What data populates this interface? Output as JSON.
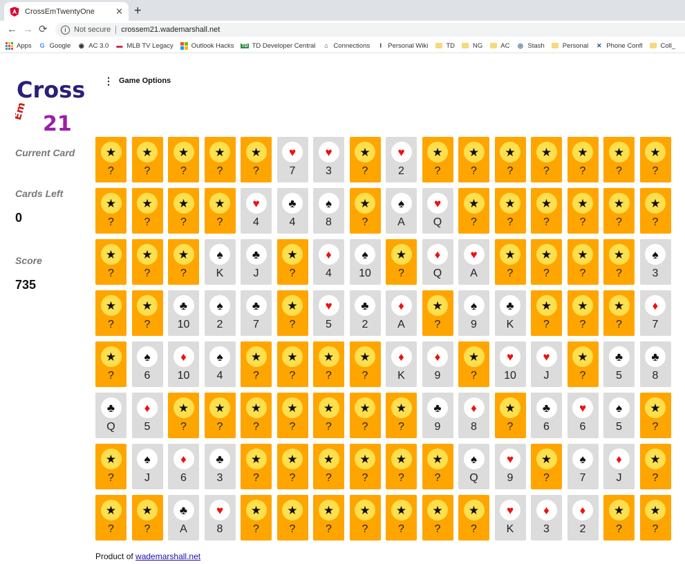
{
  "browser": {
    "tab_title": "CrossEmTwentyOne",
    "close_glyph": "✕",
    "new_tab_glyph": "+",
    "back_glyph": "←",
    "forward_glyph": "→",
    "reload_glyph": "⟳",
    "security_label": "Not secure",
    "url": "crossem21.wademarshall.net",
    "bookmarks": [
      {
        "label": "Apps",
        "icon": "apps-grid-icon"
      },
      {
        "label": "Google",
        "icon": "google-icon"
      },
      {
        "label": "AC 3.0",
        "icon": "ac-icon"
      },
      {
        "label": "MLB TV Legacy",
        "icon": "mlb-icon"
      },
      {
        "label": "Outlook Hacks",
        "icon": "windows-icon"
      },
      {
        "label": "TD Developer Central",
        "icon": "td-icon"
      },
      {
        "label": "Connections",
        "icon": "connections-icon"
      },
      {
        "label": "Personal Wiki",
        "icon": "wiki-icon"
      },
      {
        "label": "TD",
        "icon": "folder-icon"
      },
      {
        "label": "NG",
        "icon": "folder-icon"
      },
      {
        "label": "AC",
        "icon": "folder-icon"
      },
      {
        "label": "Stash",
        "icon": "stash-icon"
      },
      {
        "label": "Personal",
        "icon": "folder-icon"
      },
      {
        "label": "Phone Confl",
        "icon": "tools-icon"
      },
      {
        "label": "Coll_",
        "icon": "folder-icon"
      }
    ]
  },
  "logo": {
    "line1": "Cross",
    "line2": "Em",
    "line3": "21"
  },
  "menu": {
    "game_options_label": "Game Options"
  },
  "sidebar": {
    "current_card_label": "Current Card",
    "cards_left_label": "Cards Left",
    "cards_left_value": "0",
    "score_label": "Score",
    "score_value": "735"
  },
  "board": {
    "hidden_symbol": "★",
    "hidden_label": "?",
    "suit_symbols": {
      "H": "♥",
      "D": "♦",
      "C": "♣",
      "S": "♠"
    },
    "colors": {
      "hidden_bg": "#ffa500",
      "hidden_badge": "#fedf4e",
      "revealed_bg": "#dcdcdc",
      "red_suit": "#ee1111",
      "black_suit": "#111111"
    },
    "rows": [
      [
        "?",
        "?",
        "?",
        "?",
        "?",
        "H7",
        "H3",
        "?",
        "H2",
        "?",
        "?",
        "?",
        "?",
        "?",
        "?",
        "?"
      ],
      [
        "?",
        "?",
        "?",
        "?",
        "H4",
        "C4",
        "S8",
        "?",
        "SA",
        "HQ",
        "?",
        "?",
        "?",
        "?",
        "?",
        "?"
      ],
      [
        "?",
        "?",
        "?",
        "SK",
        "CJ",
        "?",
        "D4",
        "S10",
        "?",
        "DQ",
        "HA",
        "?",
        "?",
        "?",
        "?",
        "S3"
      ],
      [
        "?",
        "?",
        "C10",
        "S2",
        "C7",
        "?",
        "H5",
        "C2",
        "DA",
        "?",
        "S9",
        "CK",
        "?",
        "?",
        "?",
        "D7"
      ],
      [
        "?",
        "S6",
        "D10",
        "S4",
        "?",
        "?",
        "?",
        "?",
        "DK",
        "D9",
        "?",
        "H10",
        "HJ",
        "?",
        "C5",
        "C8"
      ],
      [
        "CQ",
        "D5",
        "?",
        "?",
        "?",
        "?",
        "?",
        "?",
        "?",
        "C9",
        "D8",
        "?",
        "C6",
        "H6",
        "S5",
        "?"
      ],
      [
        "?",
        "SJ",
        "D6",
        "C3",
        "?",
        "?",
        "?",
        "?",
        "?",
        "?",
        "SQ",
        "H9",
        "?",
        "S7",
        "DJ",
        "?"
      ],
      [
        "?",
        "?",
        "CA",
        "H8",
        "?",
        "?",
        "?",
        "?",
        "?",
        "?",
        "?",
        "HK",
        "D3",
        "D2",
        "?",
        "?"
      ]
    ]
  },
  "footer": {
    "prefix": "Product of",
    "link_text": "wademarshall.net"
  }
}
